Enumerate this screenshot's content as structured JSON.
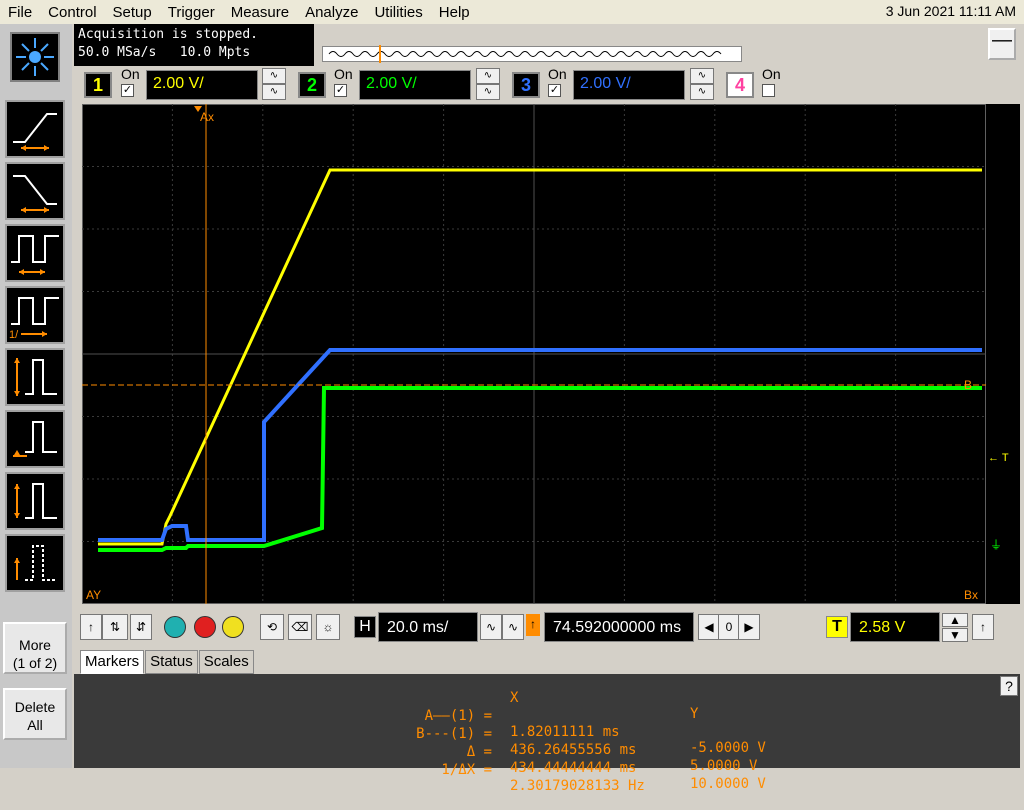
{
  "menu": [
    "File",
    "Control",
    "Setup",
    "Trigger",
    "Measure",
    "Analyze",
    "Utilities",
    "Help"
  ],
  "datetime": "3 Jun 2021 11:11 AM",
  "status": {
    "line1": "Acquisition is stopped.",
    "line2": "50.0 MSa/s   10.0 Mpts"
  },
  "channels": [
    {
      "num": "1",
      "on_label": "On",
      "checked": true,
      "scale": "2.00 V/",
      "color": "#ffff00"
    },
    {
      "num": "2",
      "on_label": "On",
      "checked": true,
      "scale": "2.00 V/",
      "color": "#00ff00"
    },
    {
      "num": "3",
      "on_label": "On",
      "checked": true,
      "scale": "2.00 V/",
      "color": "#3070ff"
    },
    {
      "num": "4",
      "on_label": "On",
      "checked": false,
      "scale": "",
      "color": "#ff40a0"
    }
  ],
  "left_buttons": {
    "more_line1": "More",
    "more_line2": "(1 of 2)",
    "delete_line1": "Delete",
    "delete_line2": "All"
  },
  "graticule_labels": {
    "ax": "Ax",
    "ay": "AY",
    "bx": "Bx",
    "by": "B",
    "trig": "T"
  },
  "timebase": {
    "h_label": "H",
    "scale": "20.0 ms/",
    "delay": "74.592000000 ms",
    "ref": "0",
    "t_label": "T",
    "trigger_level": "2.58 V"
  },
  "tabs": [
    "Markers",
    "Status",
    "Scales"
  ],
  "markers": {
    "header_x": "X",
    "header_y": "Y",
    "rows": [
      {
        "label": "A——(1) =",
        "x": "1.82011111 ms",
        "y": "-5.0000 V"
      },
      {
        "label": "B---(1) =",
        "x": "436.26455556 ms",
        "y": "5.0000 V"
      },
      {
        "label": "Δ =",
        "x": "434.44444444 ms",
        "y": "10.0000 V"
      },
      {
        "label": "1/ΔX =",
        "x": "2.30179028133 Hz",
        "y": ""
      }
    ]
  }
}
